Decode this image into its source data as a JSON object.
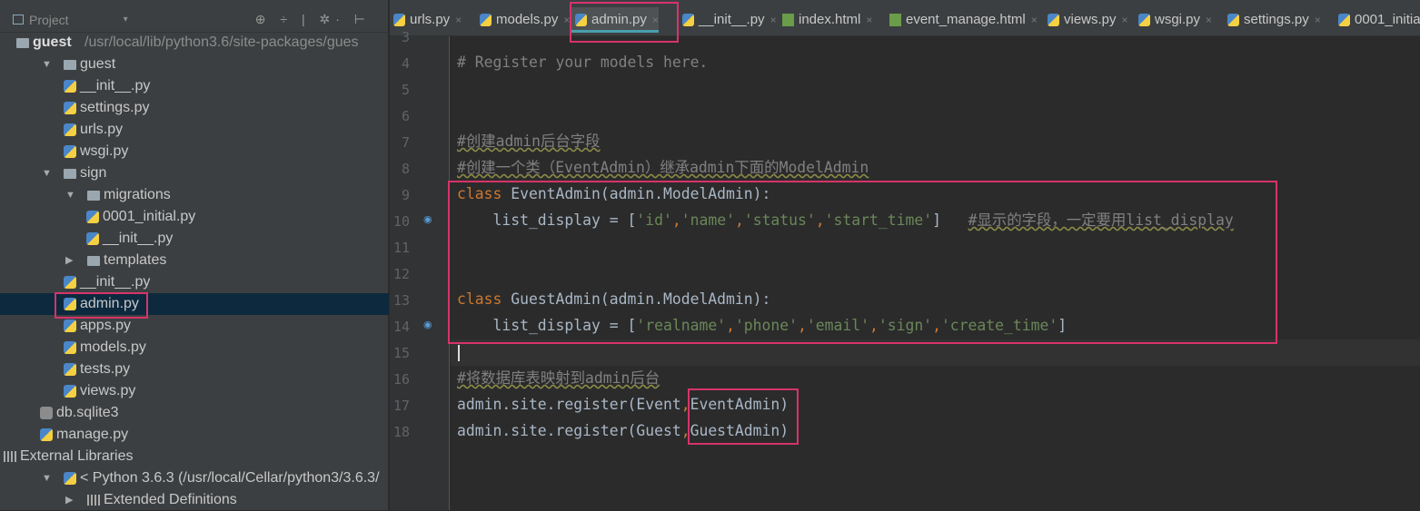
{
  "project_panel": {
    "title": "Project",
    "tools": "⊕ ÷ | ✲· ⊢",
    "tree": [
      {
        "label": "guest",
        "path": "/usr/local/lib/python3.6/site-packages/gues",
        "type": "folder",
        "depth": 0,
        "bold": true
      },
      {
        "label": "guest",
        "type": "folder",
        "depth": 1,
        "arrow": "▼"
      },
      {
        "label": "__init__.py",
        "type": "py",
        "depth": 2
      },
      {
        "label": "settings.py",
        "type": "py",
        "depth": 2
      },
      {
        "label": "urls.py",
        "type": "py",
        "depth": 2
      },
      {
        "label": "wsgi.py",
        "type": "py",
        "depth": 2
      },
      {
        "label": "sign",
        "type": "folder",
        "depth": 1,
        "arrow": "▼"
      },
      {
        "label": "migrations",
        "type": "folder",
        "depth": 2,
        "arrow": "▼"
      },
      {
        "label": "0001_initial.py",
        "type": "py",
        "depth": 3
      },
      {
        "label": "__init__.py",
        "type": "py",
        "depth": 3
      },
      {
        "label": "templates",
        "type": "folder",
        "depth": 2,
        "arrow": "▶"
      },
      {
        "label": "__init__.py",
        "type": "py",
        "depth": 2
      },
      {
        "label": "admin.py",
        "type": "py",
        "depth": 2,
        "selected": true
      },
      {
        "label": "apps.py",
        "type": "py",
        "depth": 2
      },
      {
        "label": "models.py",
        "type": "py",
        "depth": 2
      },
      {
        "label": "tests.py",
        "type": "py",
        "depth": 2
      },
      {
        "label": "views.py",
        "type": "py",
        "depth": 2
      },
      {
        "label": "db.sqlite3",
        "type": "db",
        "depth": 1
      },
      {
        "label": "manage.py",
        "type": "py",
        "depth": 1
      },
      {
        "label": "External Libraries",
        "type": "lib",
        "depth": 0
      },
      {
        "label": "< Python 3.6.3 (/usr/local/Cellar/python3/3.6.3/",
        "type": "py",
        "depth": 1,
        "arrow": "▼"
      },
      {
        "label": "Extended Definitions",
        "type": "lib",
        "depth": 2,
        "arrow": "▶"
      }
    ]
  },
  "tabs": [
    {
      "label": "urls.py",
      "type": "py"
    },
    {
      "label": "models.py",
      "type": "py"
    },
    {
      "label": "admin.py",
      "type": "py",
      "active": true
    },
    {
      "label": "__init__.py",
      "type": "py"
    },
    {
      "label": "index.html",
      "type": "html"
    },
    {
      "label": "event_manage.html",
      "type": "html"
    },
    {
      "label": "views.py",
      "type": "py"
    },
    {
      "label": "wsgi.py",
      "type": "py"
    },
    {
      "label": "settings.py",
      "type": "py"
    },
    {
      "label": "0001_initia",
      "type": "py"
    }
  ],
  "editor": {
    "lines": [
      {
        "n": "3",
        "tokens": []
      },
      {
        "n": "4",
        "tokens": [
          {
            "t": "# Register your models here.",
            "k": "cmp"
          }
        ]
      },
      {
        "n": "5",
        "tokens": []
      },
      {
        "n": "6",
        "tokens": []
      },
      {
        "n": "7",
        "tokens": [
          {
            "t": "#创建admin后台字段",
            "k": "cm"
          }
        ]
      },
      {
        "n": "8",
        "tokens": [
          {
            "t": "#创建一个类（EventAdmin）继承admin下面的ModelAdmin",
            "k": "cm"
          }
        ]
      },
      {
        "n": "9",
        "tokens": [
          {
            "t": "class",
            "k": "kw"
          },
          {
            "t": " EventAdmin(admin.ModelAdmin):",
            "k": ""
          }
        ]
      },
      {
        "n": "10",
        "tokens": [
          {
            "t": "    list_display = [",
            "k": ""
          },
          {
            "t": "'id'",
            "k": "str"
          },
          {
            "t": ",",
            "k": "cn"
          },
          {
            "t": "'name'",
            "k": "str"
          },
          {
            "t": ",",
            "k": "cn"
          },
          {
            "t": "'status'",
            "k": "str"
          },
          {
            "t": ",",
            "k": "cn"
          },
          {
            "t": "'start_time'",
            "k": "str"
          },
          {
            "t": "]   ",
            "k": ""
          },
          {
            "t": "#显示的字段，一定要用list_display",
            "k": "cm"
          }
        ]
      },
      {
        "n": "11",
        "tokens": []
      },
      {
        "n": "12",
        "tokens": []
      },
      {
        "n": "13",
        "tokens": [
          {
            "t": "class",
            "k": "kw"
          },
          {
            "t": " GuestAdmin(admin.ModelAdmin):",
            "k": ""
          }
        ]
      },
      {
        "n": "14",
        "tokens": [
          {
            "t": "    list_display = [",
            "k": ""
          },
          {
            "t": "'realname'",
            "k": "str"
          },
          {
            "t": ",",
            "k": "cn"
          },
          {
            "t": "'phone'",
            "k": "str"
          },
          {
            "t": ",",
            "k": "cn"
          },
          {
            "t": "'email'",
            "k": "str"
          },
          {
            "t": ",",
            "k": "cn"
          },
          {
            "t": "'sign'",
            "k": "str"
          },
          {
            "t": ",",
            "k": "cn"
          },
          {
            "t": "'create_time'",
            "k": "str"
          },
          {
            "t": "]",
            "k": ""
          }
        ]
      },
      {
        "n": "15",
        "tokens": []
      },
      {
        "n": "16",
        "tokens": [
          {
            "t": "#将数据库表映射到admin后台",
            "k": "cm"
          }
        ]
      },
      {
        "n": "17",
        "tokens": [
          {
            "t": "admin.site.register(Event",
            "k": ""
          },
          {
            "t": ",",
            "k": "cn"
          },
          {
            "t": "EventAdmin)",
            "k": ""
          }
        ]
      },
      {
        "n": "18",
        "tokens": [
          {
            "t": "admin.site.register(Guest",
            "k": ""
          },
          {
            "t": ",",
            "k": "cn"
          },
          {
            "t": "GuestAdmin)",
            "k": ""
          }
        ]
      }
    ]
  },
  "colors": {
    "highlight": "#d7336a",
    "keyword": "#cc7832",
    "string": "#6a8759",
    "comment": "#808080",
    "tab_underline": "#4a9fae"
  }
}
